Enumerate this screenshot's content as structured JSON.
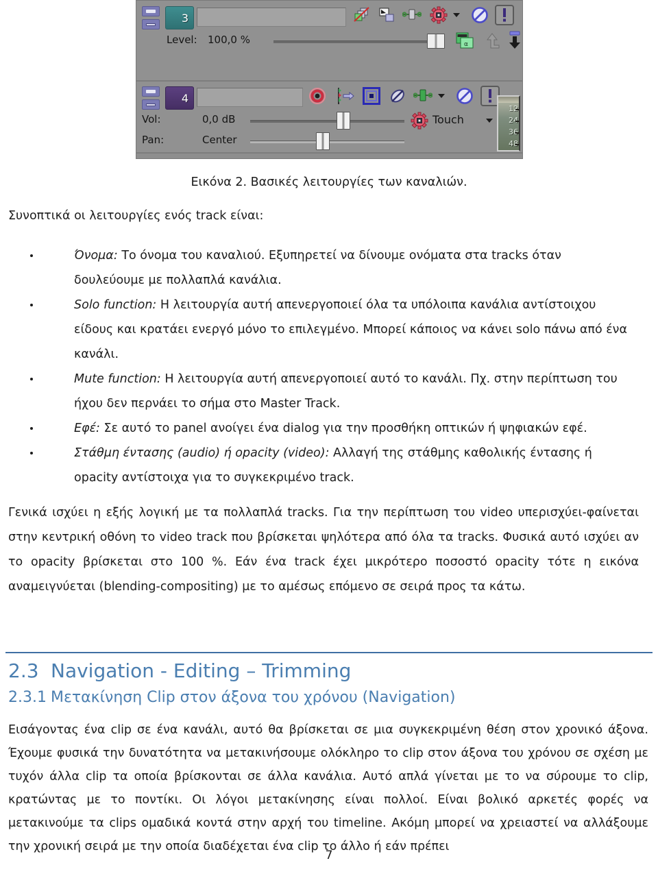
{
  "figure": {
    "alt_name": "vegas-track-header-screenshot",
    "video_track": {
      "number": "3",
      "name_value": "",
      "level_label": "Level:",
      "level_value": "100,0 %",
      "icons": [
        "compositing-mode-icon",
        "make-compositing-child-icon",
        "track-fx-icon",
        "automation-settings-icon",
        "mute-icon",
        "solo-icon",
        "motion-blur-icon",
        "parent-overlay-icon",
        "child-overlay-icon"
      ]
    },
    "audio_track": {
      "number": "4",
      "name_value": "",
      "vol_label": "Vol:",
      "vol_value": "0,0 dB",
      "pan_label": "Pan:",
      "pan_value": "Center",
      "automation_mode": "Touch",
      "icons": [
        "record-arm-icon",
        "input-monitor-icon",
        "phase-invert-icon",
        "track-fx-icon",
        "mute-icon",
        "solo-icon",
        "automation-settings-icon"
      ],
      "meter_ticks": [
        "12",
        "24",
        "36",
        "48"
      ]
    },
    "colors": {
      "panel_bg": "#919191",
      "video_track_accent": "#357a7c",
      "audio_track_accent": "#523a75",
      "meter_bg": "#7e8d7e"
    }
  },
  "document": {
    "figure_caption": "Εικόνα 2. Βασικές λειτουργίες των καναλιών.",
    "intro_line": "Συνοπτικά οι λειτουργίες ενός track είναι:",
    "bullets": [
      {
        "term": "Όνομα:",
        "text": " Το όνομα του καναλιού. Εξυπηρετεί να δίνουμε ονόματα στα tracks όταν δουλεύουμε με πολλαπλά κανάλια."
      },
      {
        "term": "Solo function:",
        "text": " Η λειτουργία αυτή απενεργοποιεί όλα τα υπόλοιπα κανάλια αντίστοιχου είδους και κρατάει ενεργό μόνο το επιλεγμένο. Μπορεί κάποιος να κάνει solo πάνω από ένα κανάλι."
      },
      {
        "term": "Mute function:",
        "text": " Η λειτουργία αυτή απενεργοποιεί αυτό το κανάλι. Πχ. στην περίπτωση του ήχου δεν περνάει το σήμα στο Master Track."
      },
      {
        "term": "Εφέ:",
        "text": " Σε αυτό το panel ανοίγει ένα dialog για την προσθήκη οπτικών ή ψηφιακών εφέ."
      },
      {
        "term": "Στάθμη έντασης (audio) ή opacity (video):",
        "text": " Αλλαγή της στάθμης καθολικής έντασης ή opacity αντίστοιχα για το συγκεκριμένο track."
      }
    ],
    "paragraph_general": "Γενικά ισχύει η εξής λογική με τα πολλαπλά tracks. Για την περίπτωση του video υπερισχύει-φαίνεται στην κεντρική οθόνη το video track που βρίσκεται ψηλότερα από όλα τα tracks. Φυσικά αυτό ισχύει αν το opacity βρίσκεται στο 100 %.  Εάν ένα track έχει μικρότερο ποσοστό opacity τότε η εικόνα αναμειγνύεται (blending-compositing) με το αμέσως επόμενο σε σειρά προς τα κάτω.",
    "heading_2_3": {
      "number": "2.3",
      "title": "Navigation - Editing – Trimming"
    },
    "heading_2_3_1": {
      "number": "2.3.1",
      "title": "Μετακίνηση Clip στον άξονα του χρόνου (Navigation)"
    },
    "paragraph_navigation": "Εισάγοντας ένα clip σε ένα κανάλι, αυτό θα βρίσκεται σε μια συγκεκριμένη θέση στον χρονικό άξονα. Έχουμε φυσικά την δυνατότητα να μετακινήσουμε ολόκληρο το clip στον άξονα του χρόνου σε σχέση με τυχόν άλλα clip τα οποία βρίσκονται σε άλλα κανάλια. Αυτό απλά γίνεται με το να σύρουμε το clip, κρατώντας με το ποντίκι. Οι λόγοι μετακίνησης είναι πολλοί. Είναι βολικό αρκετές φορές να μετακινούμε τα clips ομαδικά κοντά στην αρχή του timeline. Ακόμη μπορεί να χρειαστεί να αλλάξουμε την χρονική σειρά με την οποία διαδέχεται ένα clip το άλλο ή εάν πρέπει",
    "page_number": "7",
    "heading_color": "#4a7eb0"
  }
}
